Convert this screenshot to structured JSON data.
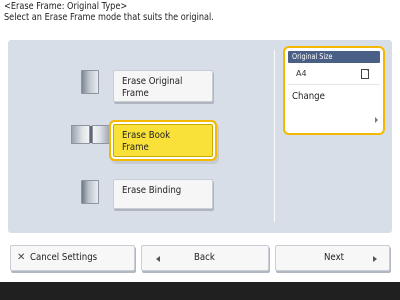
{
  "header": {
    "title": "<Erase Frame: Original Type>",
    "instruction": "Select an Erase Frame mode that suits the original."
  },
  "modes": [
    {
      "label": "Erase Original\nFrame",
      "icon": "single-page-icon",
      "selected": false
    },
    {
      "label": "Erase Book\nFrame",
      "icon": "open-book-icon",
      "selected": true
    },
    {
      "label": "Erase Binding",
      "icon": "bound-pages-icon",
      "selected": false
    }
  ],
  "original_size": {
    "title": "Original Size",
    "value": "A4",
    "orientation_icon": "portrait-sheet-icon",
    "change_label": "Change"
  },
  "footer": {
    "cancel_label": "Cancel Settings",
    "back_label": "Back",
    "next_label": "Next"
  },
  "colors": {
    "accent_selected": "#f9e13a",
    "focus_border": "#f5b800",
    "panel_bg": "#d7dee7",
    "title_bar": "#4a5f86"
  }
}
